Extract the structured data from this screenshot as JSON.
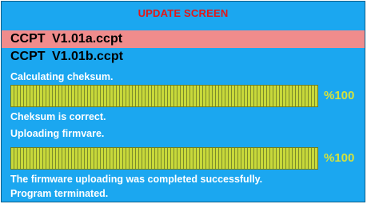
{
  "title": "UPDATE SCREEN",
  "files": [
    {
      "name": "CCPT  V1.01a.ccpt",
      "selected": true
    },
    {
      "name": "CCPT  V1.01b.ccpt",
      "selected": false
    }
  ],
  "checksum": {
    "status": "Calculating cheksum.",
    "progress_label": "%100",
    "progress_value": 1.0,
    "result": "Cheksum is correct."
  },
  "upload": {
    "status": "Uploading firmvare.",
    "progress_label": "%100",
    "progress_value": 1.0,
    "result": "The firmware uploading was completed successfully.",
    "final": "Program terminated."
  },
  "colors": {
    "background": "#1ba7f0",
    "title": "#e21818",
    "selected_row": "#f08c8c",
    "bar_fill": "#c8d93a",
    "percent_text": "#d6e23b"
  }
}
